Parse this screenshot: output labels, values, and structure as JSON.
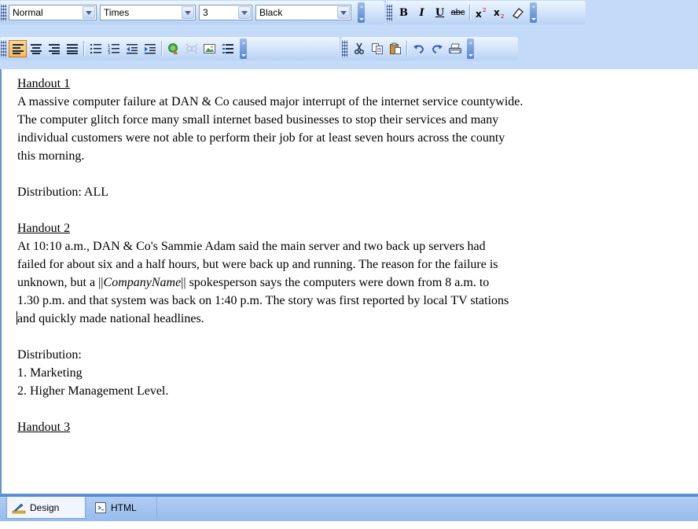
{
  "toolbar": {
    "paragraph_style": "Normal",
    "font_name": "Times",
    "font_size": "3",
    "font_color": "Black",
    "bold_label": "B",
    "italic_label": "I",
    "underline_label": "U",
    "strike_label": "abc"
  },
  "document": {
    "handout1_title": "Handout 1",
    "handout1_lines": [
      "A massive computer failure at  DAN & Co caused major interrupt of the internet service countywide.",
      "The computer glitch force many small internet based businesses to stop their services and many",
      "individual customers were not able to perform their job for at least seven hours across the county",
      "this morning."
    ],
    "distribution1": "Distribution: ALL",
    "handout2_title": "Handout 2",
    "handout2_line1": "At 10:10 a.m.,  DAN & Co's  Sammie Adam said the main server and two back up servers had",
    "handout2_line2": "failed for about six and a half hours, but were back up and running. The reason for the failure is",
    "handout2_line3_pre": "unknown, but a ||",
    "handout2_line3_italic": "CompanyName",
    "handout2_line3_post": "|| spokesperson says the computers were down from 8 a.m. to",
    "handout2_line4": "1.30 p.m. and that system was back on 1:40 p.m. The story was first reported by local TV stations",
    "handout2_line5": "and quickly made national headlines.",
    "distribution2": "Distribution:",
    "distribution2_items": [
      "1. Marketing",
      "2. Higher Management Level."
    ],
    "handout3_title": "Handout 3"
  },
  "tabs": {
    "design": "Design",
    "html": "HTML"
  }
}
